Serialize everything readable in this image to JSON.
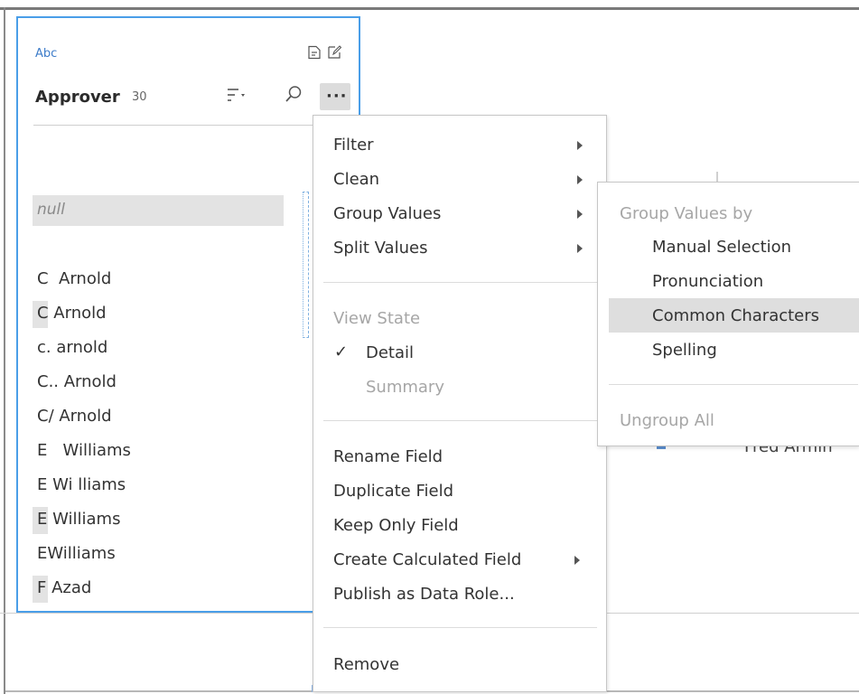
{
  "card": {
    "data_type": "Abc",
    "title": "Approver",
    "count": "30",
    "more_label": "···",
    "values": [
      {
        "text": "null",
        "kind": "null"
      },
      {
        "text": "",
        "kind": "empty"
      },
      {
        "text": "C  Arnold",
        "kind": "plain"
      },
      {
        "text": "C Arnold",
        "kind": "highlight"
      },
      {
        "text": "c. arnold",
        "kind": "plain"
      },
      {
        "text": "C.. Arnold",
        "kind": "plain"
      },
      {
        "text": "C/ Arnold",
        "kind": "plain"
      },
      {
        "text": "E   Williams",
        "kind": "plain"
      },
      {
        "text": "E Wi lliams",
        "kind": "plain"
      },
      {
        "text": "E Williams",
        "kind": "highlight"
      },
      {
        "text": "EWilliams",
        "kind": "plain"
      },
      {
        "text": "F Azad",
        "kind": "highlight"
      }
    ]
  },
  "menu": {
    "filter": "Filter",
    "clean": "Clean",
    "group_values": "Group Values",
    "split_values": "Split Values",
    "view_state_header": "View State",
    "detail": "Detail",
    "detail_check": "✓",
    "summary": "Summary",
    "rename_field": "Rename Field",
    "duplicate_field": "Duplicate Field",
    "keep_only_field": "Keep Only Field",
    "create_calculated_field": "Create Calculated Field",
    "publish_as_data_role": "Publish as Data Role...",
    "remove": "Remove"
  },
  "submenu": {
    "header": "Group Values by",
    "manual_selection": "Manual Selection",
    "pronunciation": "Pronunciation",
    "common_characters": "Common Characters",
    "spelling": "Spelling",
    "ungroup_all": "Ungroup All"
  },
  "background": {
    "partial_text": "Fred Armin"
  },
  "colors": {
    "accent": "#4a9ee8",
    "highlight": "#dedede"
  }
}
